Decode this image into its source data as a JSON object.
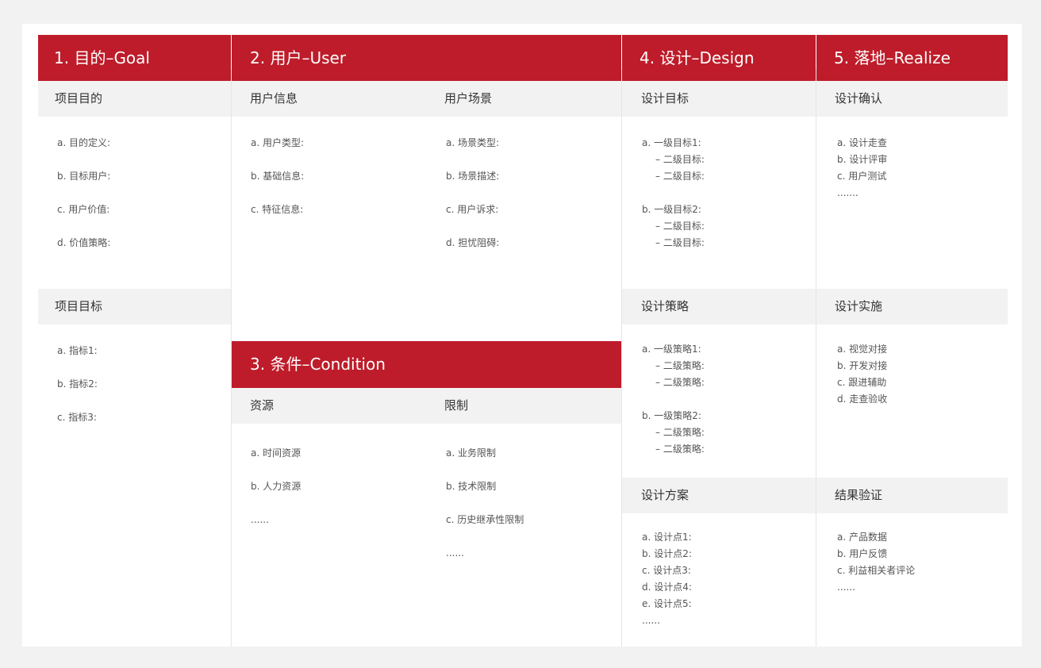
{
  "goal": {
    "title": "1. 目的–Goal",
    "sections": [
      {
        "title": "项目目的",
        "items": [
          "a. 目的定义:",
          "b. 目标用户:",
          "c. 用户价值:",
          "d. 价值策略:"
        ]
      },
      {
        "title": "项目目标",
        "items": [
          "a. 指标1:",
          "b. 指标2:",
          "c. 指标3:"
        ]
      }
    ]
  },
  "user": {
    "title": "2. 用户–User",
    "columns": [
      {
        "title": "用户信息",
        "items": [
          "a. 用户类型:",
          "b. 基础信息:",
          "c. 特征信息:"
        ]
      },
      {
        "title": "用户场景",
        "items": [
          "a. 场景类型:",
          "b. 场景描述:",
          "c. 用户诉求:",
          "d. 担忧阻碍:"
        ]
      }
    ]
  },
  "condition": {
    "title": "3. 条件–Condition",
    "columns": [
      {
        "title": "资源",
        "items": [
          "a. 时间资源",
          "b. 人力资源",
          "......"
        ]
      },
      {
        "title": "限制",
        "items": [
          "a. 业务限制",
          "b. 技术限制",
          "c. 历史继承性限制",
          "......"
        ]
      }
    ]
  },
  "design": {
    "title": "4. 设计–Design",
    "sections": [
      {
        "title": "设计目标",
        "items": [
          "a. 一级目标1:",
          "– 二级目标:",
          "– 二级目标:",
          "b. 一级目标2:",
          "– 二级目标:",
          "– 二级目标:"
        ]
      },
      {
        "title": "设计策略",
        "items": [
          "a. 一级策略1:",
          "– 二级策略:",
          "– 二级策略:",
          "b. 一级策略2:",
          "– 二级策略:",
          "– 二级策略:"
        ]
      },
      {
        "title": "设计方案",
        "items": [
          "a. 设计点1:",
          "b. 设计点2:",
          "c. 设计点3:",
          "d. 设计点4:",
          "e. 设计点5:",
          "......"
        ]
      }
    ]
  },
  "realize": {
    "title": "5. 落地–Realize",
    "sections": [
      {
        "title": "设计确认",
        "items": [
          "a. 设计走查",
          "b. 设计评审",
          "c. 用户测试",
          "......."
        ]
      },
      {
        "title": "设计实施",
        "items": [
          "a. 视觉对接",
          "b. 开发对接",
          "c. 跟进辅助",
          "d. 走查验收"
        ]
      },
      {
        "title": "结果验证",
        "items": [
          "a. 产品数据",
          "b. 用户反馈",
          "c. 利益相关者评论",
          "......"
        ]
      }
    ]
  }
}
